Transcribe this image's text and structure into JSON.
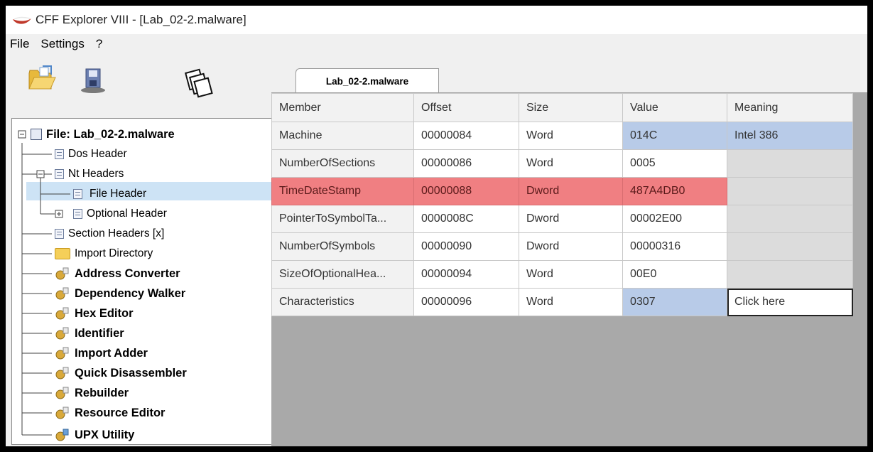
{
  "window": {
    "title": "CFF Explorer VIII - [Lab_02-2.malware]"
  },
  "menu": [
    "File",
    "Settings",
    "?"
  ],
  "toolbar": {
    "buttons": [
      {
        "name": "open-file",
        "icon": "folder-open-icon"
      },
      {
        "name": "save",
        "icon": "floppy-save-icon"
      },
      {
        "name": "windows",
        "icon": "cascade-windows-icon"
      }
    ]
  },
  "tree": {
    "root": "File: Lab_02-2.malware",
    "items": [
      {
        "label": "Dos Header",
        "icon": "doc-icon",
        "bold": false
      },
      {
        "label": "Nt Headers",
        "icon": "doc-icon",
        "bold": false
      },
      {
        "label": "File Header",
        "icon": "doc-icon",
        "bold": false,
        "selected": true
      },
      {
        "label": "Optional Header",
        "icon": "doc-icon",
        "bold": false
      },
      {
        "label": "Section Headers [x]",
        "icon": "doc-icon",
        "bold": false
      },
      {
        "label": "Import Directory",
        "icon": "folder-icon",
        "bold": false
      },
      {
        "label": "Address Converter",
        "icon": "tool-icon",
        "bold": true
      },
      {
        "label": "Dependency Walker",
        "icon": "tool-icon",
        "bold": true
      },
      {
        "label": "Hex Editor",
        "icon": "tool-icon",
        "bold": true
      },
      {
        "label": "Identifier",
        "icon": "tool-icon",
        "bold": true
      },
      {
        "label": "Import Adder",
        "icon": "tool-icon",
        "bold": true
      },
      {
        "label": "Quick Disassembler",
        "icon": "tool-icon",
        "bold": true
      },
      {
        "label": "Rebuilder",
        "icon": "tool-icon",
        "bold": true
      },
      {
        "label": "Resource Editor",
        "icon": "tool-icon",
        "bold": true
      },
      {
        "label": "UPX Utility",
        "icon": "tool-icon",
        "bold": true
      }
    ]
  },
  "tab": {
    "label": "Lab_02-2.malware"
  },
  "table": {
    "columns": [
      "Member",
      "Offset",
      "Size",
      "Value",
      "Meaning"
    ],
    "rows": [
      [
        "Machine",
        "00000084",
        "Word",
        "014C",
        "Intel 386"
      ],
      [
        "NumberOfSections",
        "00000086",
        "Word",
        "0005",
        ""
      ],
      [
        "TimeDateStamp",
        "00000088",
        "Dword",
        "487A4DB0",
        ""
      ],
      [
        "PointerToSymbolTa...",
        "0000008C",
        "Dword",
        "00002E00",
        ""
      ],
      [
        "NumberOfSymbols",
        "00000090",
        "Dword",
        "00000316",
        ""
      ],
      [
        "SizeOfOptionalHea...",
        "00000094",
        "Word",
        "00E0",
        ""
      ],
      [
        "Characteristics",
        "00000096",
        "Word",
        "0307",
        "Click here"
      ]
    ]
  },
  "colors": {
    "highlight_row": "#f07f82",
    "selected_value": "#b8cbe8",
    "tree_selection": "#cde3f5"
  }
}
